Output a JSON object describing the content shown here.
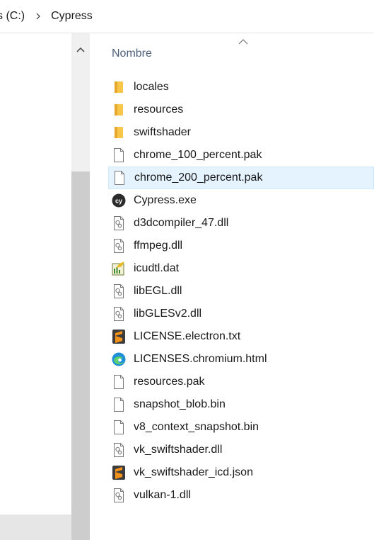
{
  "breadcrumb": {
    "items": [
      "s (C:)",
      "Cypress"
    ]
  },
  "list": {
    "column_header": "Nombre",
    "sort": "ascending",
    "selected_index": 4,
    "files": [
      {
        "name": "locales",
        "icon": "folder-icon"
      },
      {
        "name": "resources",
        "icon": "folder-icon"
      },
      {
        "name": "swiftshader",
        "icon": "folder-icon"
      },
      {
        "name": "chrome_100_percent.pak",
        "icon": "file-icon"
      },
      {
        "name": "chrome_200_percent.pak",
        "icon": "file-icon"
      },
      {
        "name": "Cypress.exe",
        "icon": "cypress-app-icon"
      },
      {
        "name": "d3dcompiler_47.dll",
        "icon": "dll-icon"
      },
      {
        "name": "ffmpeg.dll",
        "icon": "dll-icon"
      },
      {
        "name": "icudtl.dat",
        "icon": "data-file-icon"
      },
      {
        "name": "libEGL.dll",
        "icon": "dll-icon"
      },
      {
        "name": "libGLESv2.dll",
        "icon": "dll-icon"
      },
      {
        "name": "LICENSE.electron.txt",
        "icon": "sublime-text-icon"
      },
      {
        "name": "LICENSES.chromium.html",
        "icon": "edge-browser-icon"
      },
      {
        "name": "resources.pak",
        "icon": "file-icon"
      },
      {
        "name": "snapshot_blob.bin",
        "icon": "file-icon"
      },
      {
        "name": "v8_context_snapshot.bin",
        "icon": "file-icon"
      },
      {
        "name": "vk_swiftshader.dll",
        "icon": "dll-icon"
      },
      {
        "name": "vk_swiftshader_icd.json",
        "icon": "sublime-text-icon"
      },
      {
        "name": "vulkan-1.dll",
        "icon": "dll-icon"
      }
    ]
  },
  "colors": {
    "folder": "#f8c648",
    "selection_bg": "#e5f3ff",
    "header_text": "#4c607a",
    "scrollbar_track": "#f0f0f0",
    "scrollbar_thumb": "#cdcdcd"
  }
}
